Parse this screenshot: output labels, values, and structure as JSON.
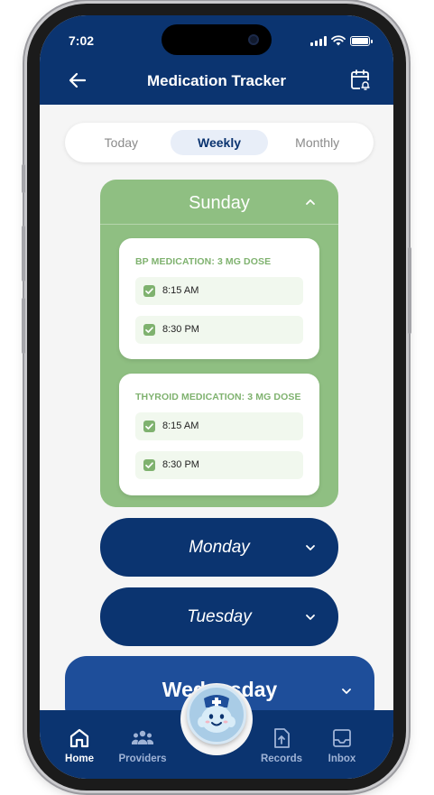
{
  "status": {
    "time": "7:02"
  },
  "header": {
    "title": "Medication Tracker",
    "back_icon": "arrow-left-icon",
    "action_icon": "calendar-bell-icon"
  },
  "tabs": [
    {
      "label": "Today",
      "active": false
    },
    {
      "label": "Weekly",
      "active": true
    },
    {
      "label": "Monthly",
      "active": false
    }
  ],
  "days": {
    "sunday": {
      "label": "Sunday",
      "expanded": true,
      "medications": [
        {
          "title": "BP MEDICATION: 3 MG DOSE",
          "doses": [
            {
              "time": "8:15 AM",
              "taken": true
            },
            {
              "time": "8:30 PM",
              "taken": true
            }
          ]
        },
        {
          "title": "THYROID MEDICATION: 3 MG DOSE",
          "doses": [
            {
              "time": "8:15 AM",
              "taken": true
            },
            {
              "time": "8:30 PM",
              "taken": true
            }
          ]
        }
      ]
    },
    "monday": {
      "label": "Monday",
      "expanded": false
    },
    "tuesday": {
      "label": "Tuesday",
      "expanded": false
    },
    "wednesday": {
      "label": "Wednesday",
      "expanded": false
    }
  },
  "nav": {
    "home": "Home",
    "providers": "Providers",
    "records": "Records",
    "inbox": "Inbox"
  },
  "colors": {
    "primary": "#0b3470",
    "sunday_green": "#8fbf82",
    "accent_green": "#7fb26f",
    "wednesday_blue": "#1e4e9a"
  }
}
